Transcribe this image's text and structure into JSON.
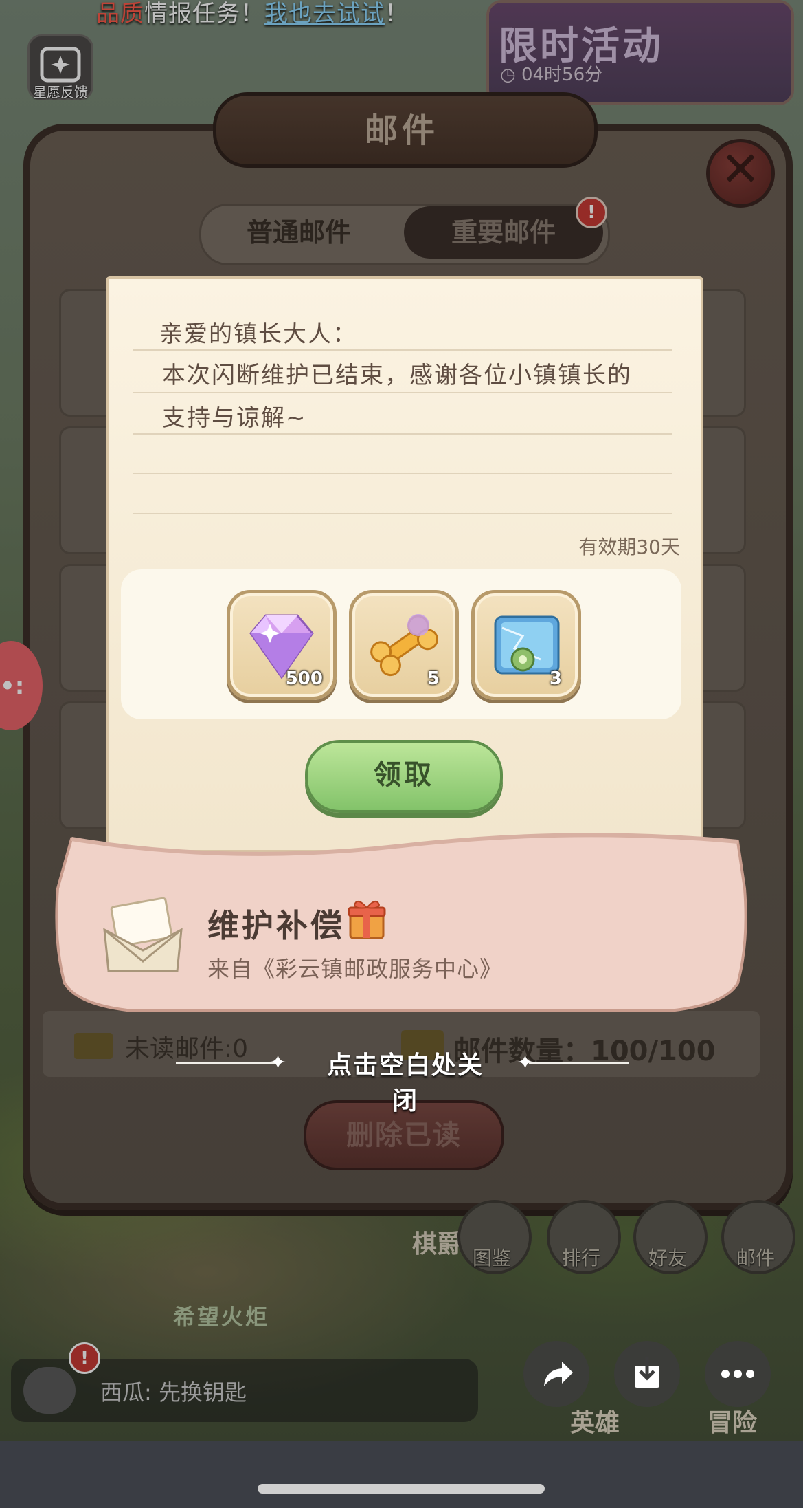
{
  "banner": {
    "prefix": "品质",
    "middle": "情报任务！",
    "link": "我也去试试",
    "suffix": "！"
  },
  "feedback": {
    "label": "星愿反馈",
    "icon": "sparkle-frame-icon"
  },
  "event": {
    "title": "限时活动",
    "timer": "04时56分",
    "icon": "clock-icon"
  },
  "mail_panel": {
    "title": "邮件",
    "tabs": [
      {
        "label": "普通邮件",
        "active": false
      },
      {
        "label": "重要邮件",
        "active": true,
        "badge": "!"
      }
    ],
    "footer": {
      "unread": "未读邮件:0",
      "count": "邮件数量：100/100"
    },
    "delete_read": "删除已读"
  },
  "letter": {
    "greeting": "亲爱的镇长大人：",
    "body_line1": "本次闪断维护已结束，感谢各位小镇镇长的",
    "body_line2": "支持与谅解~",
    "validity": "有效期30天",
    "rewards": [
      {
        "icon": "diamond-gem-icon",
        "count": "500"
      },
      {
        "icon": "golden-bone-icon",
        "count": "5"
      },
      {
        "icon": "blue-chest-icon",
        "count": "3"
      }
    ],
    "claim": "领取"
  },
  "mail_item": {
    "title": "维护补偿",
    "from": "来自《彩云镇邮政服务中心》",
    "icons": [
      "envelope-icon",
      "gift-box-icon"
    ]
  },
  "close_hint": "点击空白处关闭",
  "bottom_nav": {
    "chess": "棋爵",
    "items": [
      "图鉴",
      "排行",
      "好友",
      "邮件"
    ],
    "torch": "希望火炬",
    "hero": "英雄",
    "adventure": "冒险"
  },
  "chat": {
    "text": "西瓜: 先换钥匙",
    "badge": "!"
  },
  "overlay_buttons": [
    "share-icon",
    "save-icon",
    "more-icon"
  ],
  "colors": {
    "claim_green": "#83c36a",
    "paper": "#fbf3e2",
    "flap_pink": "#f0d2c8",
    "badge_red": "#c73a34"
  }
}
